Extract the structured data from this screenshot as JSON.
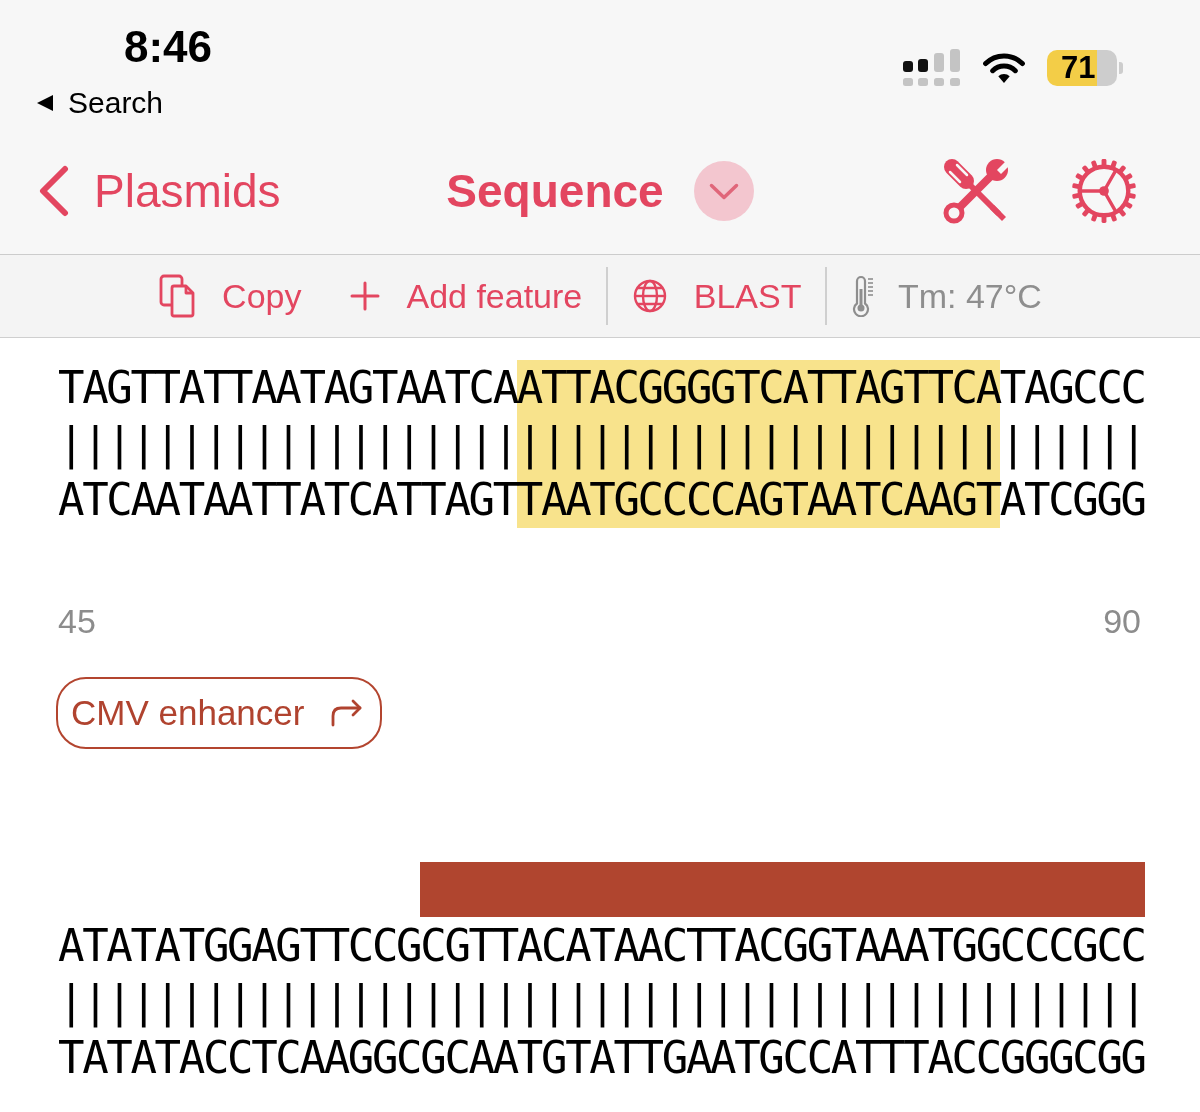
{
  "status_bar": {
    "time": "8:46",
    "back_label": "Search",
    "battery": "71"
  },
  "nav_bar": {
    "back_label": "Plasmids",
    "title": "Sequence"
  },
  "toolbar": {
    "groups": [
      [
        {
          "kind": "copy",
          "label": "Copy"
        },
        {
          "kind": "add",
          "label": "Add feature"
        }
      ],
      [
        {
          "kind": "blast",
          "label": "BLAST"
        }
      ],
      [
        {
          "kind": "tm",
          "label": "Tm: 47°C"
        }
      ]
    ]
  },
  "blocks": [
    {
      "segments": [
        {
          "top": "TAGTTATTAATAGTAATCA",
          "bonds": "|||||||||||||||||||",
          "bottom": "ATCAATAATTATCATTAGT",
          "selected": false,
          "in_feature": false
        },
        {
          "top": "ATTACGGGGTCATTAGTTCA",
          "bonds": "||||||||||||||||||||",
          "bottom": "TAATGCCCCAGTAATCAAGT",
          "selected": true,
          "in_feature": false
        },
        {
          "top": "TAGCCC",
          "bonds": "||||||",
          "bottom": "ATCGGG",
          "selected": false,
          "in_feature": false
        }
      ]
    },
    {
      "ruler": {
        "start": "45",
        "end": "90"
      },
      "features": [
        {
          "label": "CMV enhancer"
        }
      ],
      "segments": [
        {
          "top": "ATATATGGAGTTCCG",
          "bonds": "|||||||||||||||",
          "bottom": "TATATACCTCAAGGC",
          "selected": false,
          "in_feature": false
        },
        {
          "top": "CGTTACATAACTTACGGTAAATGGCCCGCC",
          "bonds": "||||||||||||||||||||||||||||||",
          "bottom": "GCAATGTATTGAATGCCATTTACCGGGCGG",
          "selected": false,
          "in_feature": true
        }
      ]
    }
  ]
}
